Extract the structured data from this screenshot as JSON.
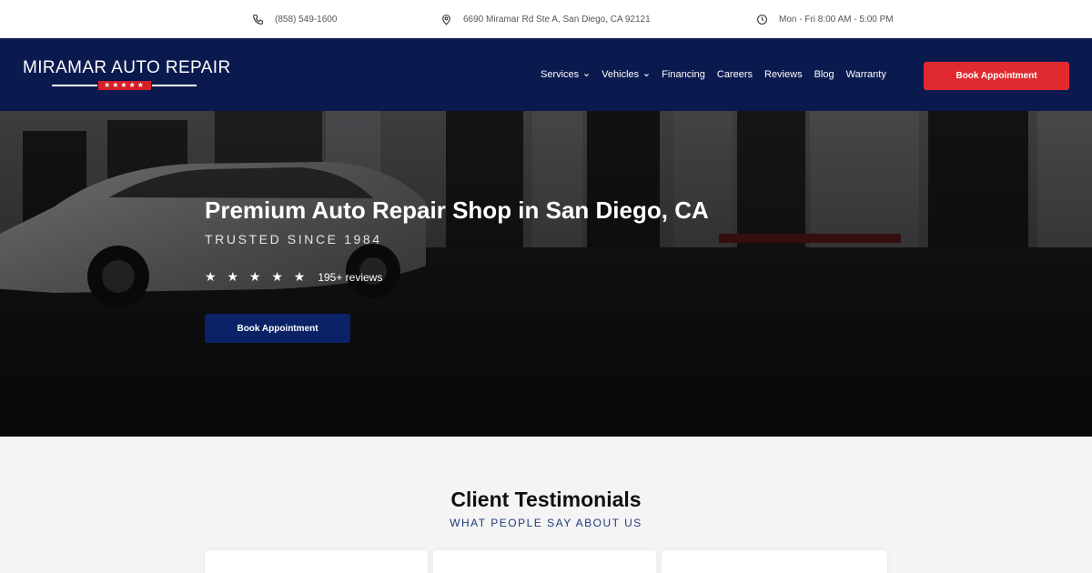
{
  "topbar": {
    "phone": "(858) 549-1600",
    "address": "6690 Miramar Rd Ste A, San Diego, CA 92121",
    "hours": "Mon - Fri 8:00 AM - 5:00 PM"
  },
  "nav": {
    "logo_text": "MIRAMAR AUTO REPAIR",
    "logo_stars": "★★★★★",
    "items": [
      {
        "label": "Services",
        "has_dropdown": true
      },
      {
        "label": "Vehicles",
        "has_dropdown": true
      },
      {
        "label": "Financing",
        "has_dropdown": false
      },
      {
        "label": "Careers",
        "has_dropdown": false
      },
      {
        "label": "Reviews",
        "has_dropdown": false
      },
      {
        "label": "Blog",
        "has_dropdown": false
      },
      {
        "label": "Warranty",
        "has_dropdown": false
      }
    ],
    "book_label": "Book Appointment"
  },
  "hero": {
    "title": "Premium Auto Repair Shop in San Diego, CA",
    "subtitle": "TRUSTED SINCE 1984",
    "stars": "★ ★ ★ ★ ★",
    "rating_stars": 5,
    "reviews": "195+ reviews",
    "book_label": "Book Appointment"
  },
  "testimonials": {
    "title": "Client Testimonials",
    "subtitle": "WHAT PEOPLE SAY ABOUT US"
  },
  "colors": {
    "nav_bg": "#0b1a4e",
    "accent_red": "#e02a2f",
    "hero_button": "#0b2266",
    "subtitle_blue": "#1e3a7a"
  }
}
